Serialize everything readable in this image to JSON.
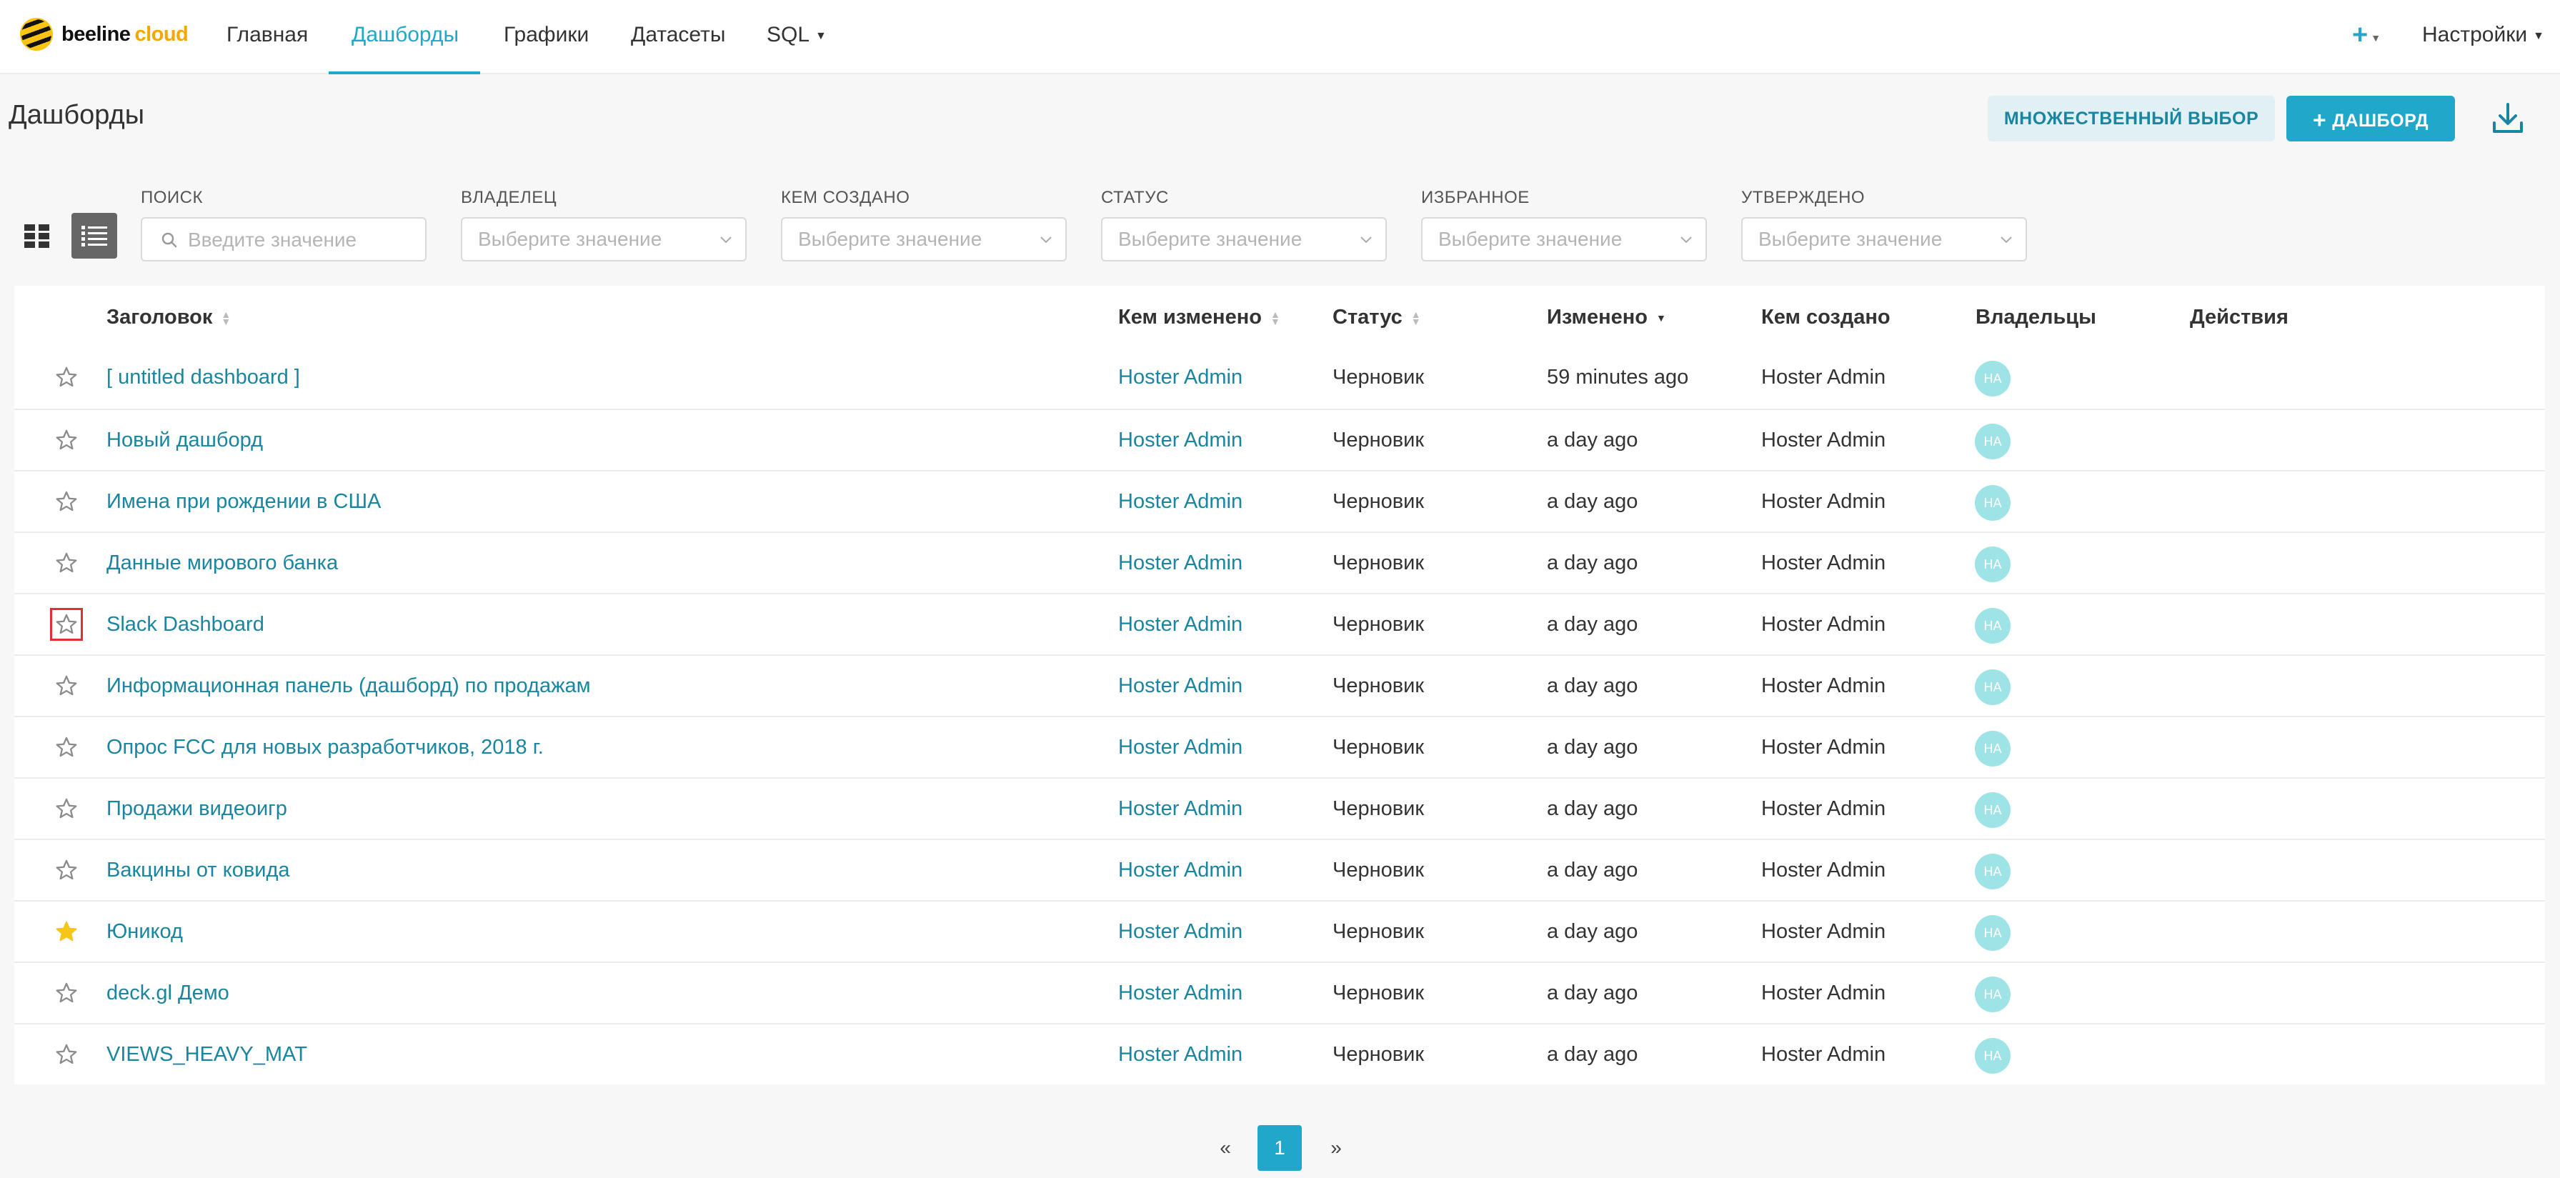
{
  "brand": {
    "name": "beeline",
    "suffix": "cloud"
  },
  "nav": {
    "items": [
      {
        "label": "Главная"
      },
      {
        "label": "Дашборды",
        "active": true
      },
      {
        "label": "Графики"
      },
      {
        "label": "Датасеты"
      },
      {
        "label": "SQL"
      }
    ],
    "settings_label": "Настройки"
  },
  "page": {
    "title": "Дашборды"
  },
  "actions": {
    "multi_select_label": "МНОЖЕСТВЕННЫЙ ВЫБОР",
    "add_dashboard_label": "ДАШБОРД"
  },
  "filters": {
    "search": {
      "label": "ПОИСК",
      "placeholder": "Введите значение"
    },
    "owner": {
      "label": "ВЛАДЕЛЕЦ",
      "placeholder": "Выберите значение"
    },
    "created_by": {
      "label": "КЕМ СОЗДАНО",
      "placeholder": "Выберите значение"
    },
    "status": {
      "label": "СТАТУС",
      "placeholder": "Выберите значение"
    },
    "favorite": {
      "label": "ИЗБРАННОЕ",
      "placeholder": "Выберите значение"
    },
    "certified": {
      "label": "УТВЕРЖДЕНО",
      "placeholder": "Выберите значение"
    }
  },
  "table": {
    "headers": {
      "title": "Заголовок",
      "modified_by": "Кем изменено",
      "status": "Статус",
      "modified": "Изменено",
      "created_by": "Кем создано",
      "owners": "Владельцы",
      "actions": "Действия"
    },
    "rows": [
      {
        "title": "[ untitled dashboard ]",
        "modified_by": "Hoster Admin",
        "status": "Черновик",
        "modified": "59 minutes ago",
        "created_by": "Hoster Admin",
        "owner": "HA",
        "favorite": false
      },
      {
        "title": "Новый дашборд",
        "modified_by": "Hoster Admin",
        "status": "Черновик",
        "modified": "a day ago",
        "created_by": "Hoster Admin",
        "owner": "HA",
        "favorite": false
      },
      {
        "title": "Имена при рождении в США",
        "modified_by": "Hoster Admin",
        "status": "Черновик",
        "modified": "a day ago",
        "created_by": "Hoster Admin",
        "owner": "HA",
        "favorite": false
      },
      {
        "title": "Данные мирового банка",
        "modified_by": "Hoster Admin",
        "status": "Черновик",
        "modified": "a day ago",
        "created_by": "Hoster Admin",
        "owner": "HA",
        "favorite": false
      },
      {
        "title": "Slack Dashboard",
        "modified_by": "Hoster Admin",
        "status": "Черновик",
        "modified": "a day ago",
        "created_by": "Hoster Admin",
        "owner": "HA",
        "favorite": false
      },
      {
        "title": "Информационная панель (дашборд) по продажам",
        "modified_by": "Hoster Admin",
        "status": "Черновик",
        "modified": "a day ago",
        "created_by": "Hoster Admin",
        "owner": "HA",
        "favorite": false
      },
      {
        "title": "Опрос FCC для новых разработчиков, 2018 г.",
        "modified_by": "Hoster Admin",
        "status": "Черновик",
        "modified": "a day ago",
        "created_by": "Hoster Admin",
        "owner": "HA",
        "favorite": false
      },
      {
        "title": "Продажи видеоигр",
        "modified_by": "Hoster Admin",
        "status": "Черновик",
        "modified": "a day ago",
        "created_by": "Hoster Admin",
        "owner": "HA",
        "favorite": false
      },
      {
        "title": "Вакцины от ковида",
        "modified_by": "Hoster Admin",
        "status": "Черновик",
        "modified": "a day ago",
        "created_by": "Hoster Admin",
        "owner": "HA",
        "favorite": false
      },
      {
        "title": "Юникод",
        "modified_by": "Hoster Admin",
        "status": "Черновик",
        "modified": "a day ago",
        "created_by": "Hoster Admin",
        "owner": "HA",
        "favorite": true
      },
      {
        "title": "deck.gl Демо",
        "modified_by": "Hoster Admin",
        "status": "Черновик",
        "modified": "a day ago",
        "created_by": "Hoster Admin",
        "owner": "HA",
        "favorite": false
      },
      {
        "title": "VIEWS_HEAVY_MAT",
        "modified_by": "Hoster Admin",
        "status": "Черновик",
        "modified": "a day ago",
        "created_by": "Hoster Admin",
        "owner": "HA",
        "favorite": false
      }
    ]
  },
  "pagination": {
    "prev": "«",
    "current": "1",
    "next": "»"
  },
  "colors": {
    "accent": "#20a7c9",
    "link": "#1a85a0",
    "favorite": "#f5c518",
    "focus": "#e0302f"
  },
  "icons": {
    "logo": "beeline-logo-icon",
    "add": "plus-icon",
    "download": "download-icon",
    "grid_view": "grid-view-icon",
    "list_view": "list-view-icon",
    "search": "search-icon",
    "dropdown": "chevron-down-icon",
    "favorite": "star-icon"
  }
}
